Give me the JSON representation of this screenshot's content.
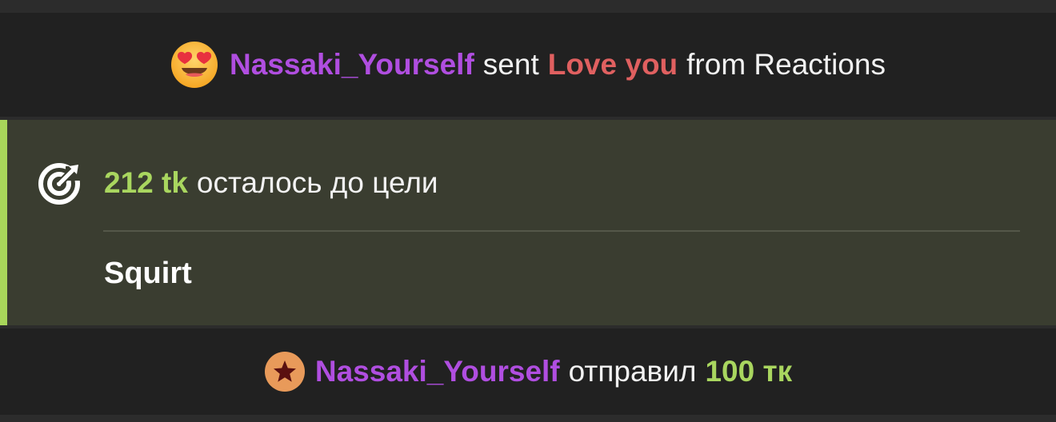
{
  "reaction": {
    "icon": "heart-eyes-emoji-icon",
    "username": "Nassaki_Yourself",
    "verb": "sent",
    "reaction_name": "Love you",
    "suffix": "from Reactions",
    "colors": {
      "username": "#b04ee0",
      "reaction": "#e06060"
    }
  },
  "goal": {
    "icon": "target-icon",
    "amount": "212 tk",
    "remaining_text": "осталось до цели",
    "title": "Squirt",
    "colors": {
      "accent": "#a8d65a",
      "background": "#3a3d30"
    }
  },
  "tip": {
    "icon": "star-badge-icon",
    "username": "Nassaki_Yourself",
    "verb": "отправил",
    "amount": "100 тк",
    "colors": {
      "username": "#b04ee0",
      "amount": "#a9d65f"
    }
  }
}
